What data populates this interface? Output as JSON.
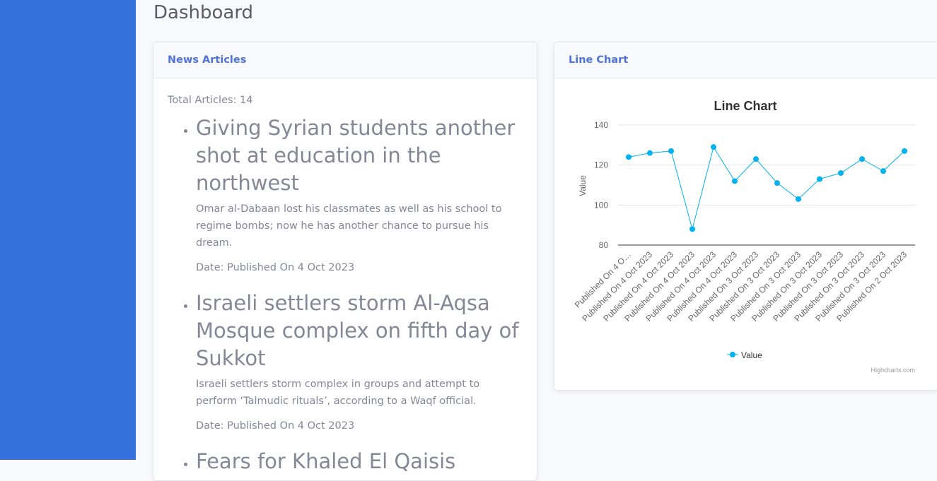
{
  "page": {
    "title": "Dashboard"
  },
  "news": {
    "header": "News Articles",
    "total_label": "Total Articles: 14",
    "articles": [
      {
        "title": "Giving Syrian students another shot at education in the northwest",
        "description": "Omar al-Dabaan lost his classmates as well as his school to regime bombs; now he has another chance to pursue his dream.",
        "date": "Date: Published On 4 Oct 2023"
      },
      {
        "title": "Israeli settlers storm Al-Aqsa Mosque complex on fifth day of Sukkot",
        "description": "Israeli settlers storm complex in groups and attempt to perform ‘Talmudic rituals’, according to a Waqf official.",
        "date": "Date: Published On 4 Oct 2023"
      },
      {
        "title": "Fears for Khaled El Qaisis",
        "description": "",
        "date": ""
      }
    ]
  },
  "chart_card": {
    "header": "Line Chart"
  },
  "chart_data": {
    "type": "line",
    "title": "Line Chart",
    "ylabel": "Value",
    "xlabel": "",
    "ylim": [
      80,
      140
    ],
    "yticks": [
      80,
      100,
      120,
      140
    ],
    "categories": [
      "Published On 4 O…",
      "Published On 4 Oct 2023",
      "Published On 4 Oct 2023",
      "Published On 4 Oct 2023",
      "Published On 4 Oct 2023",
      "Published On 4 Oct 2023",
      "Published On 3 Oct 2023",
      "Published On 3 Oct 2023",
      "Published On 3 Oct 2023",
      "Published On 3 Oct 2023",
      "Published On 3 Oct 2023",
      "Published On 3 Oct 2023",
      "Published On 3 Oct 2023",
      "Published On 2 Oct 2023"
    ],
    "series": [
      {
        "name": "Value",
        "values": [
          124,
          126,
          127,
          88,
          129,
          112,
          123,
          111,
          103,
          113,
          116,
          123,
          117,
          127
        ]
      }
    ],
    "grid": true,
    "legend": "bottom-center",
    "credits": "Highcharts.com",
    "color": "#00b3f0"
  }
}
